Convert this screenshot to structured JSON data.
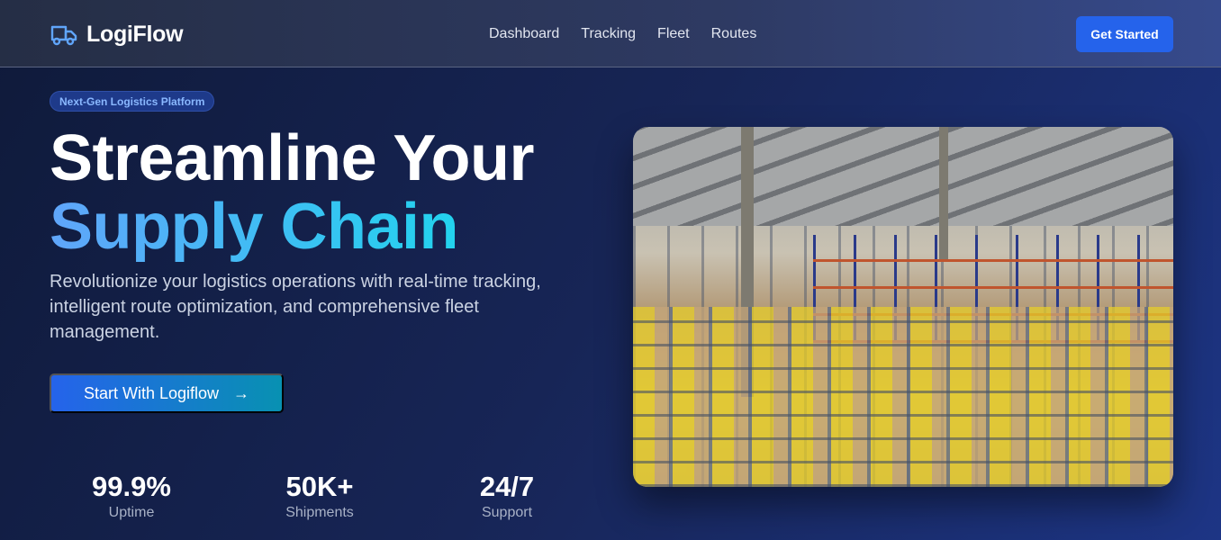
{
  "nav": {
    "brand": "LogiFlow",
    "links": [
      "Dashboard",
      "Tracking",
      "Fleet",
      "Routes"
    ],
    "cta": "Get Started"
  },
  "hero": {
    "badge": "Next-Gen Logistics Platform",
    "title_line1": "Streamline Your",
    "title_line2": "Supply Chain",
    "description": "Revolutionize your logistics operations with real-time tracking, intelligent route optimization, and comprehensive fleet management.",
    "button": "Start With Logiflow",
    "button_icon": "arrow-right-icon"
  },
  "stats": [
    {
      "value": "99.9%",
      "label": "Uptime"
    },
    {
      "value": "50K+",
      "label": "Shipments"
    },
    {
      "value": "24/7",
      "label": "Support"
    }
  ],
  "colors": {
    "accent": "#2563eb",
    "gradient_from": "#60a5fa",
    "gradient_to": "#22d3ee"
  }
}
